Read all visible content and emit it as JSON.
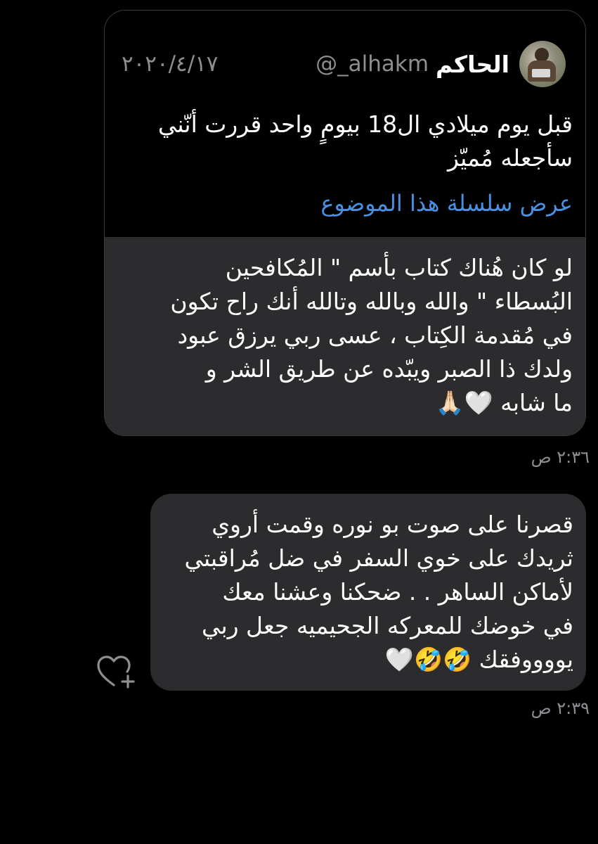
{
  "quoted_tweet": {
    "display_name": "الحاكم",
    "handle": "@_alhakm",
    "date": "٢٠٢٠/٤/١٧",
    "text": "قبل يوم ميلادي ال18 بيومٍ واحد قررت أنّني\nسأجعله مُميّز",
    "thread_link": "عرض سلسلة هذا الموضوع"
  },
  "messages": [
    {
      "text": "لو كان هُناك كتاب بأسم \" المُكافحين\nالبُسطاء \" والله وبالله وتالله أنك راح تكون\nفي مُقدمة الكِتاب ، عسى ربي يرزق عبود\nولدك ذا الصبر ويبّده عن طريق الشر و\nما شابه 🤍🙏🏻",
      "time": "٢:٣٦ ص"
    },
    {
      "text": "قصرنا على صوت بو نوره وقمت أروي\nثريدك على خوي السفر في ضل مُراقبتي\nلأماكن الساهر . .  ضحكنا وعشنا معك\nفي خوضك للمعركه الجحيميه جعل ربي\nيووووفقك 🤣🤣🤍",
      "time": "٢:٣٩ ص"
    }
  ],
  "icons": {
    "react": "heart-plus-icon",
    "avatar": "profile-avatar"
  },
  "colors": {
    "background": "#000000",
    "bubble": "#2c2c2e",
    "link": "#4a90e2",
    "muted": "#8e8e93"
  }
}
